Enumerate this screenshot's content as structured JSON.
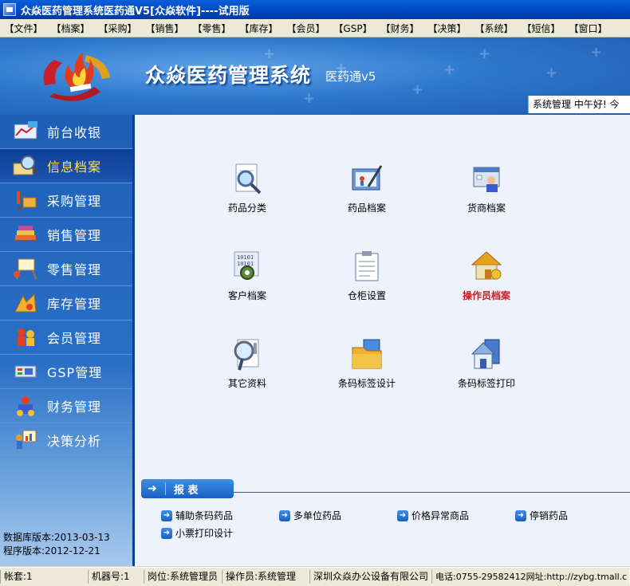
{
  "window": {
    "title": "众焱医药管理系统医药通V5[众焱软件]----试用版"
  },
  "menu": [
    "【文件】",
    "【档案】",
    "【采购】",
    "【销售】",
    "【零售】",
    "【库存】",
    "【会员】",
    "【GSP】",
    "【财务】",
    "【决策】",
    "【系统】",
    "【短信】",
    "【窗口】",
    "【"
  ],
  "banner": {
    "title": "众焱医药管理系统",
    "subtitle": "医药通v5",
    "status_text": "系统管理 中午好! 今"
  },
  "sidebar": {
    "items": [
      {
        "label": "前台收银",
        "icon": "cash-register-icon"
      },
      {
        "label": "信息档案",
        "icon": "magnifier-icon",
        "active": true
      },
      {
        "label": "采购管理",
        "icon": "truck-icon"
      },
      {
        "label": "销售管理",
        "icon": "books-icon"
      },
      {
        "label": "零售管理",
        "icon": "easel-icon"
      },
      {
        "label": "库存管理",
        "icon": "warehouse-icon"
      },
      {
        "label": "会员管理",
        "icon": "members-icon"
      },
      {
        "label": "GSP管理",
        "icon": "gsp-icon"
      },
      {
        "label": "财务管理",
        "icon": "coins-icon"
      },
      {
        "label": "决策分析",
        "icon": "chart-icon"
      }
    ],
    "db_version": "数据库版本:2013-03-13",
    "prog_version": "程序版本:2012-12-21"
  },
  "modules": [
    {
      "label": "药品分类",
      "icon": "magnifier-doc-icon"
    },
    {
      "label": "药品档案",
      "icon": "pen-folder-icon"
    },
    {
      "label": "货商档案",
      "icon": "supplier-icon"
    },
    {
      "label": "客户档案",
      "icon": "binary-gear-icon"
    },
    {
      "label": "仓柜设置",
      "icon": "clipboard-icon"
    },
    {
      "label": "操作员档案",
      "icon": "house-key-icon",
      "highlight": true
    },
    {
      "label": "其它资料",
      "icon": "magnifier-clip-icon"
    },
    {
      "label": "条码标签设计",
      "icon": "blue-folder-icon"
    },
    {
      "label": "条码标签打印",
      "icon": "house-folder-icon"
    }
  ],
  "reports": {
    "tab_label": "报 表",
    "links": [
      "辅助条码药品",
      "多单位药品",
      "价格异常商品",
      "停销药品",
      "小票打印设计"
    ]
  },
  "status_bar": [
    "帐套:1",
    "机器号:1",
    "岗位:系统管理员",
    "操作员:系统管理",
    "深圳众焱办公设备有限公司",
    "电话:0755-29582412网址:http://zybg.tmall.c"
  ],
  "colors": {
    "accent": "#1d5fb6",
    "active_text": "#ffe35a",
    "highlight_label": "#c81e1e"
  }
}
